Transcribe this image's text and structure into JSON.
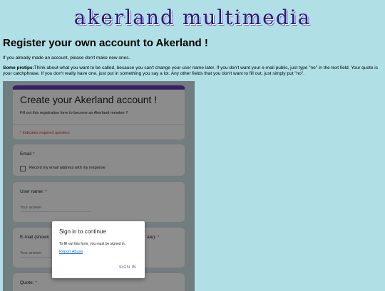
{
  "header": {
    "logo_text": "akerland multimedia"
  },
  "page": {
    "title": "Register your own account to Akerland !",
    "notice": "If you already made an account, please don't make new ones.",
    "protips_label": "Some protips:",
    "protips_text": "Think about what you want to be called, because you can't change your user name later. If you don't want your e-mail public, just type \"no\" in the text field. Your quote is your catchphrase. If you don't really have one, just put in something you say a lot. Any other fields that you don't want to fill out, just simply put \"no\"."
  },
  "form": {
    "title": "Create your Akerland account !",
    "description": "Fill out this registration form to become an Akerland member !!",
    "required_note": "* Indicates required question",
    "email": {
      "label": "Email",
      "star": "*",
      "record_label": "Record my email address with my response"
    },
    "username": {
      "label": "User name:",
      "star": "*",
      "placeholder": "Your answer"
    },
    "email_shown": {
      "label_left": "E-mail (shown",
      "label_right": "ate):",
      "star": "*",
      "placeholder": "Your answer"
    },
    "quote": {
      "label": "Quote:",
      "star": "*"
    }
  },
  "dialog": {
    "title": "Sign in to continue",
    "text": "To fill out this form, you must be signed in.",
    "link": "Report Abuse",
    "button": "SIGN IN"
  },
  "colors": {
    "background": "#b0e0e6",
    "form_accent": "#673ab7",
    "required": "#d93025",
    "link": "#1a73e8"
  }
}
